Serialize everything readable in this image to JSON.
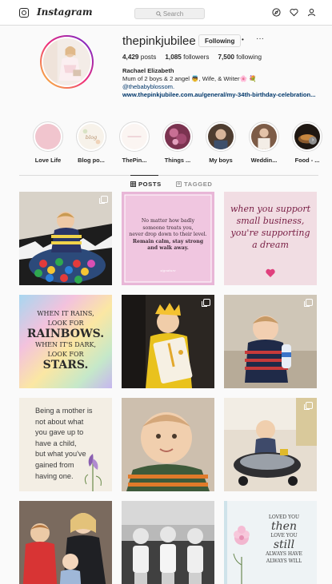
{
  "nav": {
    "logo": "Instagram",
    "search_placeholder": "Search",
    "icons": [
      "instagram-camera-icon",
      "compass-icon",
      "heart-icon",
      "person-icon"
    ]
  },
  "profile": {
    "username": "thepinkjubilee",
    "follow_label": "Following",
    "dot": "•",
    "more": "···",
    "posts_count": "4,429",
    "posts_label": "posts",
    "followers_count": "1,085",
    "followers_label": "followers",
    "following_count": "7,500",
    "following_label": "following",
    "full_name": "Rachael Elizabeth",
    "bio_line": "Mum of 2 boys & 2 angel 👼, Wife, & Writer🌸 💐",
    "mention": "@thebabyblossom.",
    "website": "www.thepinkjubilee.com.au/general/my-34th-birthday-celebration..."
  },
  "highlights": [
    {
      "label": "Love Life",
      "color": "#f0c9d0"
    },
    {
      "label": "Blog po...",
      "color": "#f6f1e8"
    },
    {
      "label": "ThePin...",
      "color": "#f8f2ef"
    },
    {
      "label": "Things ...",
      "color": "#9d4b6b"
    },
    {
      "label": "My boys",
      "color": "#6f5a4a"
    },
    {
      "label": "Weddin...",
      "color": "#8a6a55"
    },
    {
      "label": "Food - ...",
      "color": "#3a2a1e"
    }
  ],
  "tabs": {
    "posts": "POSTS",
    "tagged": "TAGGED"
  },
  "posts": {
    "p2": {
      "line1": "No matter how badly",
      "line2": "someone treats you,",
      "line3": "never drop down to their level.",
      "line4": "Remain calm, stay strong",
      "line5": "and walk away."
    },
    "p3": {
      "line1": "when you support",
      "line2": "small business,",
      "line3": "you're supporting",
      "line4": "a dream"
    },
    "p4": {
      "line1": "WHEN IT RAINS,",
      "line2": "LOOK FOR",
      "line3": "RAINBOWS.",
      "line4": "WHEN IT'S DARK,",
      "line5": "LOOK FOR",
      "line6": "STARS."
    },
    "p7": {
      "line1": "Being a mother is",
      "line2": "not about what",
      "line3": "you gave up to",
      "line4": "have a child,",
      "line5": "but what you've",
      "line6": "gained from",
      "line7": "having one."
    },
    "p12": {
      "line1": "LOVED YOU",
      "line2": "then",
      "line3": "LOVE YOU",
      "line4": "still",
      "line5": "ALWAYS HAVE",
      "line6": "ALWAYS WILL"
    }
  },
  "colors": {
    "accent_blue": "#00376b",
    "text": "#262626",
    "muted": "#8e8e8e",
    "border": "#dbdbdb"
  }
}
